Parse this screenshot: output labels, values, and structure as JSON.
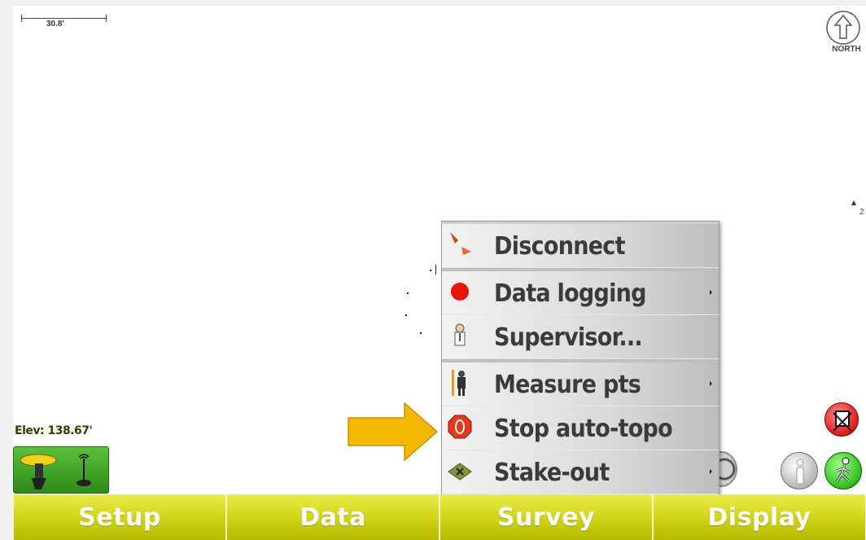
{
  "map": {
    "scale_label": "30.8'",
    "north_label": "NORTH",
    "point_label": "2"
  },
  "status": {
    "elevation": "Elev: 138.67'"
  },
  "context_menu": {
    "items": [
      {
        "label": "Disconnect",
        "icon": "disconnect-icon",
        "has_submenu": false
      },
      {
        "label": "Data logging",
        "icon": "red-dot-icon",
        "has_submenu": true
      },
      {
        "label": "Supervisor...",
        "icon": "supervisor-person-icon",
        "has_submenu": false
      },
      {
        "label": "Measure pts",
        "icon": "rod-person-icon",
        "has_submenu": true
      },
      {
        "label": "Stop auto-topo",
        "icon": "stop-sign-icon",
        "has_submenu": false
      },
      {
        "label": "Stake-out",
        "icon": "stake-out-icon",
        "has_submenu": true
      }
    ]
  },
  "toolbar": {
    "items": [
      "Setup",
      "Data",
      "Survey",
      "Display"
    ]
  },
  "colors": {
    "toolbar": "#d3d51a",
    "status_green": "#3aa11f",
    "arrow": "#f5b800"
  }
}
